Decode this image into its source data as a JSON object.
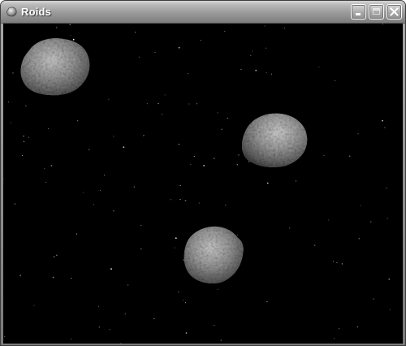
{
  "window": {
    "title": "Roids",
    "icon": "asteroid-app-icon",
    "buttons": [
      {
        "name": "minimize",
        "icon": "minimize-icon"
      },
      {
        "name": "maximize",
        "icon": "maximize-icon",
        "enabled": false
      },
      {
        "name": "close",
        "icon": "close-icon"
      }
    ]
  },
  "game": {
    "background_color": "#000000",
    "star_color": "#ffffff",
    "asteroid_count": 3,
    "asteroid_color": "#8e8e8e"
  }
}
